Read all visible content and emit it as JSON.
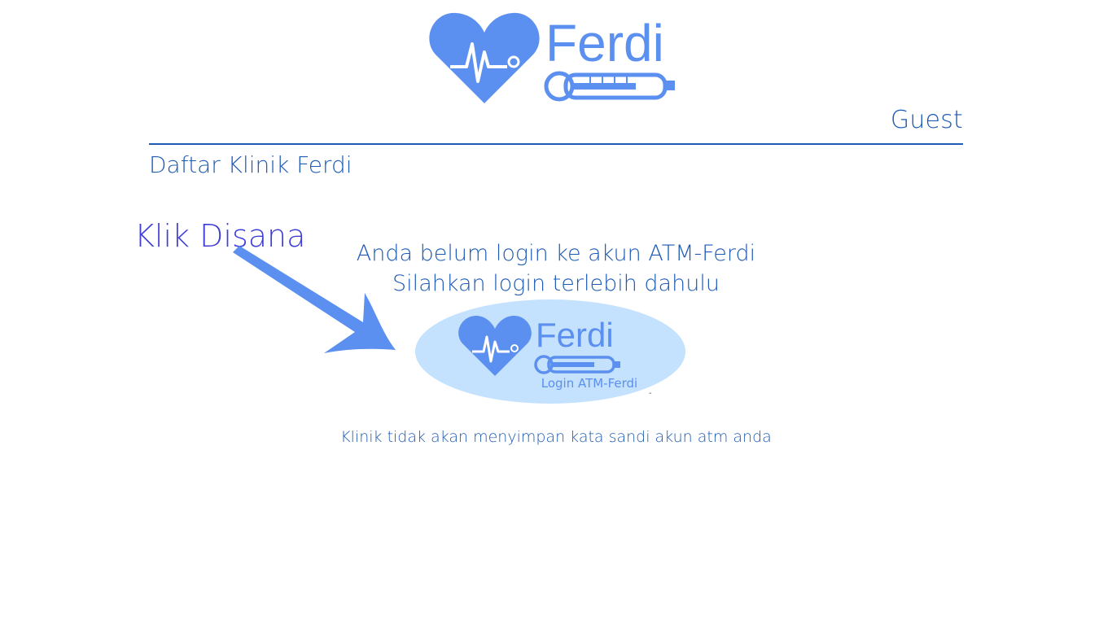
{
  "brand": {
    "name": "Ferdi",
    "color": "#5b8ff0",
    "logo_icons": [
      "heart-icon",
      "heartbeat-icon",
      "thermometer-icon"
    ]
  },
  "header": {
    "user_name": "Guest"
  },
  "page": {
    "title": "Daftar Klinik Ferdi"
  },
  "hint": {
    "label": "Klik Disana",
    "icon": "arrow-icon"
  },
  "message": {
    "line1": "Anda belum login ke akun ATM-Ferdi",
    "line2": "Silahkan login terlebih dahulu"
  },
  "login_button": {
    "brand": "Ferdi",
    "label": "Login ATM-Ferdi"
  },
  "misc": {
    "dash": "-"
  },
  "note": "Klinik tidak akan menyimpan kata sandi akun atm anda",
  "colors": {
    "primary_text": "#1e5bb5",
    "hint_text": "#3f3fd6",
    "login_bg": "#c4e1fd",
    "accent": "#5b8ff0"
  }
}
